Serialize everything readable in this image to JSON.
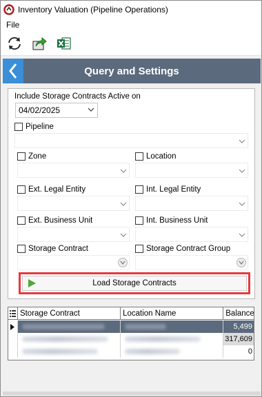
{
  "window": {
    "title": "Inventory Valuation (Pipeline Operations)"
  },
  "menu": {
    "file": "File"
  },
  "toolbar": {
    "refresh_icon": "refresh-icon",
    "export_icon": "export-arrow-icon",
    "excel_icon": "excel-icon"
  },
  "header": {
    "title": "Query and Settings"
  },
  "form": {
    "active_on_label": "Include Storage Contracts Active on",
    "date_value": "04/02/2025",
    "pipeline_label": "Pipeline",
    "zone_label": "Zone",
    "location_label": "Location",
    "ext_legal_label": "Ext. Legal Entity",
    "int_legal_label": "Int. Legal Entity",
    "ext_bu_label": "Ext. Business Unit",
    "int_bu_label": "Int. Business Unit",
    "storage_contract_label": "Storage Contract",
    "storage_group_label": "Storage Contract Group",
    "load_button": "Load Storage Contracts"
  },
  "grid": {
    "columns": [
      "Storage Contract",
      "Location Name",
      "Balance"
    ],
    "rows": [
      {
        "balance": "5,499"
      },
      {
        "balance": "317,609"
      },
      {
        "balance": "0"
      }
    ]
  },
  "colors": {
    "header_bg": "#5b6a7d",
    "back_button": "#3a8fd8",
    "highlight_border": "#e8383d",
    "selected_row": "#5b6a7d"
  }
}
